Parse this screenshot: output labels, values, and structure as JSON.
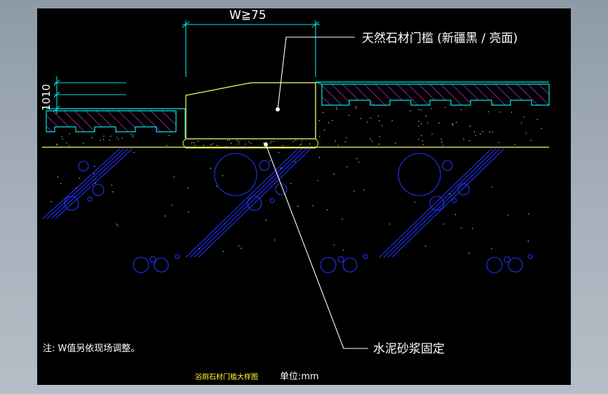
{
  "drawing": {
    "dimension_width": "W≧75",
    "dimension_height": "1010",
    "label_stone_sill": "天然石材门槛 (新疆黑 / 亮面)",
    "label_mortar": "水泥砂浆固定",
    "note": "注: W值另依现场调整。",
    "title": "浴厕石材门槛大样图",
    "unit": "单位:mm"
  },
  "colors": {
    "background": "#000000",
    "outline": "#ffff66",
    "leader": "#ffffff",
    "dimension": "#00e5e5",
    "tile_hatch": "#cc33cc",
    "gravel": "#2233ff",
    "title_text": "#ffff33",
    "annotation_text": "#ffffff"
  },
  "icons": {
    "leader_dot": "filled-circle"
  }
}
